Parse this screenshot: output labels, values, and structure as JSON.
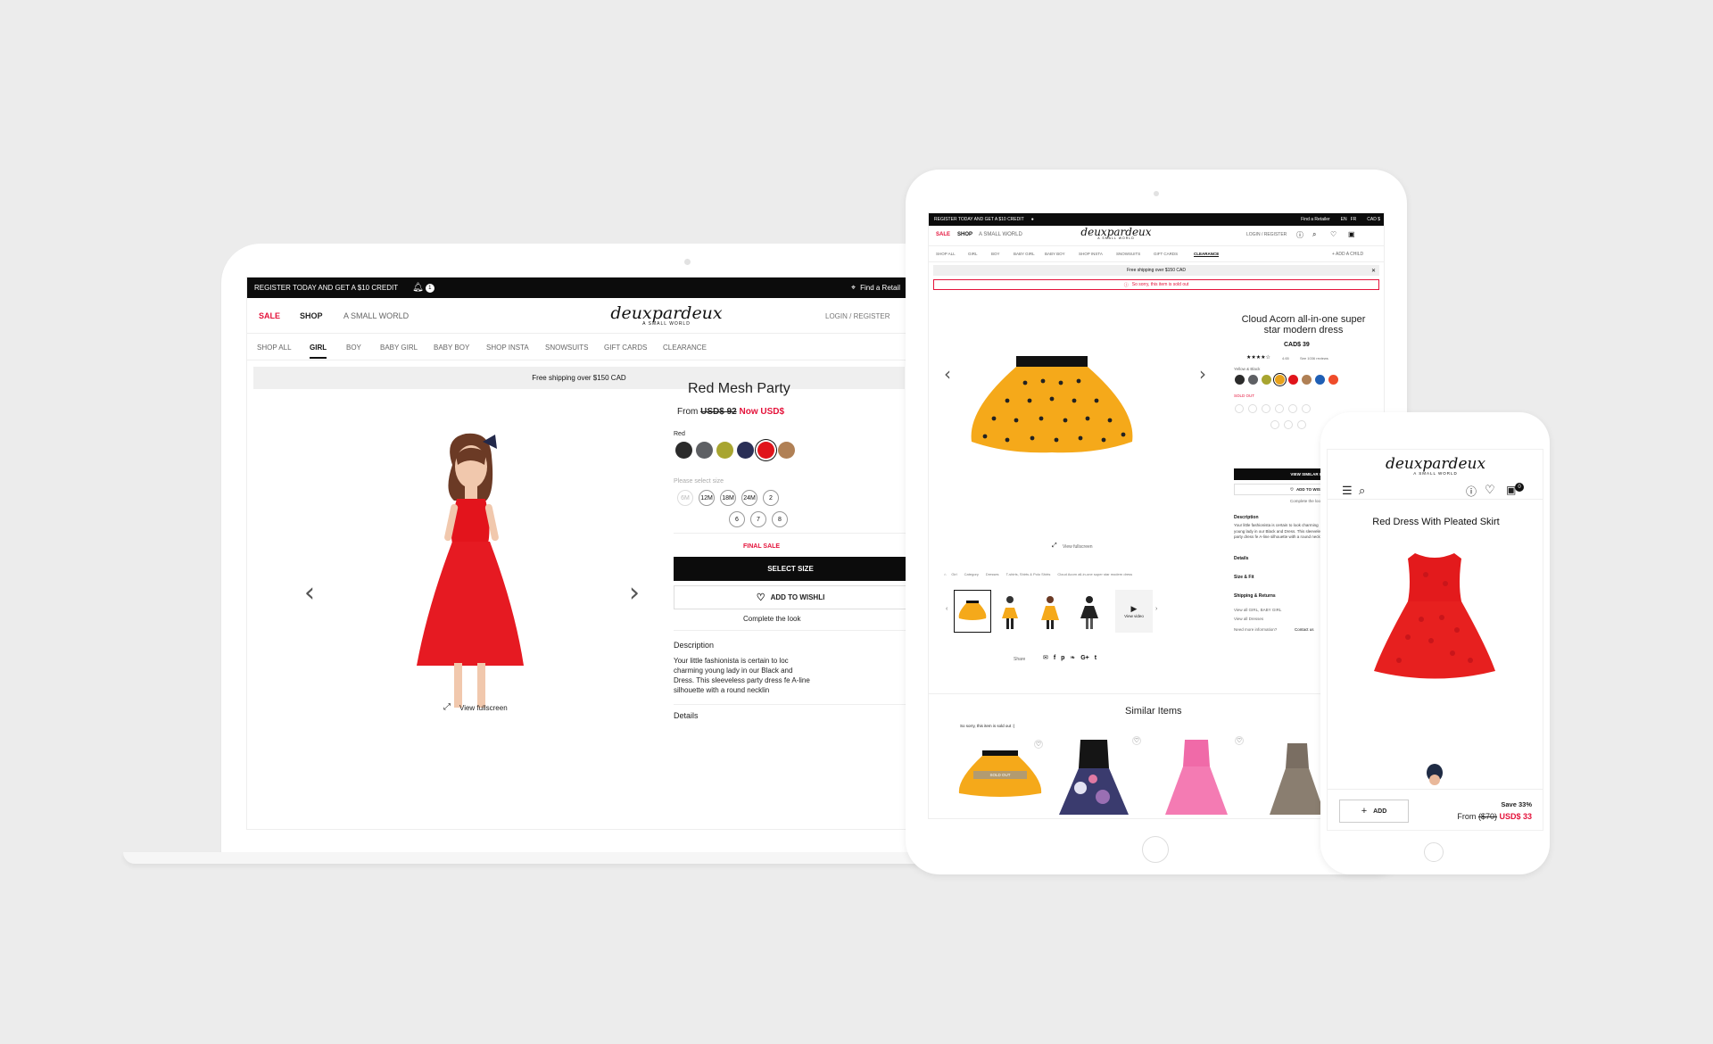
{
  "laptop": {
    "topbar": {
      "promo": "REGISTER TODAY AND GET A $10 CREDIT",
      "notif_count": "1",
      "find_retailer": "Find a Retail"
    },
    "header": {
      "sale": "SALE",
      "shop": "SHOP",
      "small_world": "A SMALL WORLD",
      "logo": "deuxpardeux",
      "logo_sub": "A SMALL WORLD",
      "login": "LOGIN",
      "register": "REGISTER"
    },
    "nav": [
      "SHOP ALL",
      "GIRL",
      "BOY",
      "BABY GIRL",
      "BABY BOY",
      "SHOP INSTA",
      "SNOWSUITS",
      "GIFT CARDS",
      "CLEARANCE"
    ],
    "shipping": "Free shipping over $150 CAD",
    "product": {
      "title": "Red Mesh Party",
      "from": "From",
      "old_price": "USD$ 92",
      "now_price": "Now USD$",
      "color_label": "Red",
      "size_label": "Please select size",
      "sizes_row1": [
        "6M",
        "12M",
        "18M",
        "24M",
        "2"
      ],
      "sizes_row2": [
        "6",
        "7",
        "8"
      ],
      "final_sale": "FINAL SALE",
      "select_size": "SELECT SIZE",
      "wishlist": "ADD TO WISHLI",
      "complete_look": "Complete the look",
      "description_h": "Description",
      "description": "Your little fashionista is certain to loc charming young lady in our Black and Dress. This sleeveless party dress fe A-line silhouette with a round necklin",
      "details_h": "Details",
      "view_fullscreen": "View fullscreen"
    },
    "colors": [
      "#2b2b2b",
      "#5e6064",
      "#a8a530",
      "#2a2f56",
      "#e0141b",
      "#b08055"
    ]
  },
  "tablet": {
    "topbar": {
      "promo": "REGISTER TODAY AND GET A $10 CREDIT",
      "find_retailer": "Find a Retailer",
      "lang_en": "EN",
      "lang_fr": "FR",
      "currency": "CAD $"
    },
    "header": {
      "sale": "SALE",
      "shop": "SHOP",
      "small_world": "A SMALL WORLD",
      "logo": "deuxpardeux",
      "logo_sub": "A SMALL WORLD",
      "login": "LOGIN / REGISTER"
    },
    "nav": [
      "SHOP ALL",
      "GIRL",
      "BOY",
      "BABY GIRL",
      "BABY BOY",
      "SHOP INSTA",
      "SNOWSUITS",
      "GIFT CARDS",
      "CLEARANCE"
    ],
    "add_child": "+ ADD A CHILD",
    "shipping": "Free shipping over $150 CAD",
    "sold_out_msg": "So sorry, this item is sold out",
    "product": {
      "title": "Cloud Acorn all-in-one super star modern dress",
      "price": "CAD$ 39",
      "rating": "4.65",
      "reviews": "See 1036 reviews",
      "color_label": "Yellow & Black",
      "sold_out": "SOLD OUT",
      "view_similar": "VIEW SIMILAR ITEM",
      "wishlist": "ADD TO WISHLIS",
      "complete_look": "Complete the look",
      "description_h": "Description",
      "description": "Your little fashionista is certain to look charming young lady in our Black and Dress. This sleeveless party dress fe A-line silhouette with a round neckli",
      "details": "Details",
      "size_fit": "Size & Fit",
      "shipping_returns": "Shipping & Returns",
      "view_girl": "View all GIRL, BABY GIRL",
      "view_dresses": "View all Dresses",
      "need_info": "Need more information?",
      "contact": "Contact us",
      "view_fullscreen": "View fullscreen",
      "share": "Share",
      "view_video": "View video"
    },
    "breadcrumb": [
      "Girl",
      "Category",
      "Dresses",
      "T-shirts, Shirts & Polo Shirts",
      "Cloud Acorn all-in-one super star modern dress"
    ],
    "colors": [
      "#2b2b2b",
      "#5e6064",
      "#a8a530",
      "#e8a21b",
      "#e0141b",
      "#b08055",
      "#1f5fb5",
      "#ef4c2a"
    ],
    "similar": {
      "title": "Similar Items",
      "sold_out_note": "So sorry, this item is sold out :(",
      "badge": "SOLD OUT"
    }
  },
  "phone": {
    "logo": "deuxpardeux",
    "logo_sub": "A SMALL WORLD",
    "cart_count": "0",
    "product_title": "Red Dress With Pleated Skirt",
    "add": "ADD",
    "save": "Save 33%",
    "from": "From",
    "old_price": "($70)",
    "price": "USD$ 33"
  }
}
